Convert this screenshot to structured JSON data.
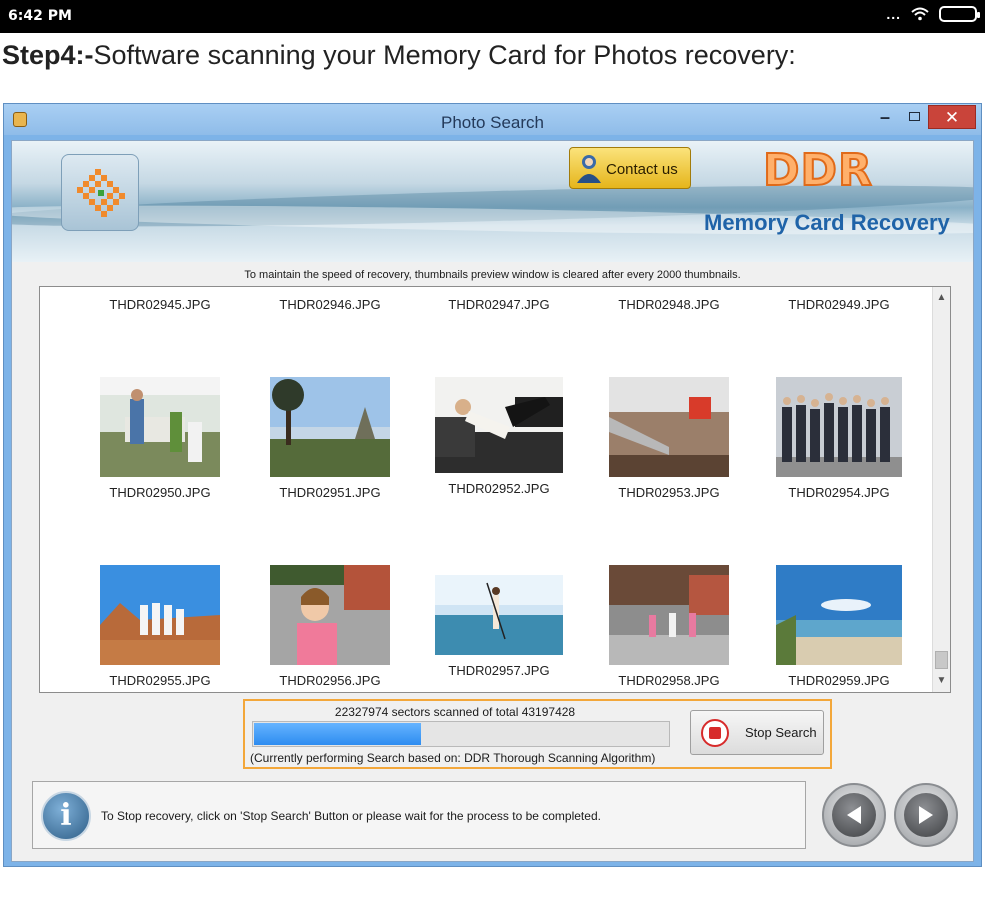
{
  "statusbar": {
    "time": "6:42 PM",
    "dots": "..."
  },
  "heading": {
    "step": "Step4:-",
    "text": "Software scanning your Memory Card for Photos recovery:"
  },
  "window": {
    "title": "Photo Search",
    "min_glyph": "–",
    "close_glyph": "✕"
  },
  "banner": {
    "contact_label": "Contact us",
    "brand": "DDR",
    "product": "Memory Card Recovery"
  },
  "notice": "To maintain the speed of recovery, thumbnails preview window is cleared after every 2000 thumbnails.",
  "thumbnails": [
    "THDR02945.JPG",
    "THDR02946.JPG",
    "THDR02947.JPG",
    "THDR02948.JPG",
    "THDR02949.JPG",
    "THDR02950.JPG",
    "THDR02951.JPG",
    "THDR02952.JPG",
    "THDR02953.JPG",
    "THDR02954.JPG",
    "THDR02955.JPG",
    "THDR02956.JPG",
    "THDR02957.JPG",
    "THDR02958.JPG",
    "THDR02959.JPG"
  ],
  "progress": {
    "stats": "22327974 sectors scanned of total 43197428",
    "fraction": 0.5169,
    "algorithm": "(Currently performing Search based on:  DDR Thorough Scanning Algorithm)",
    "stop_label": "Stop Search"
  },
  "footer": {
    "info_glyph": "i",
    "message": "To Stop recovery, click on 'Stop Search' Button or please wait for the process to be completed."
  },
  "colors": {
    "accent": "#2d8cf0",
    "highlight_border": "#f3a73a",
    "brand": "#e06a19"
  }
}
